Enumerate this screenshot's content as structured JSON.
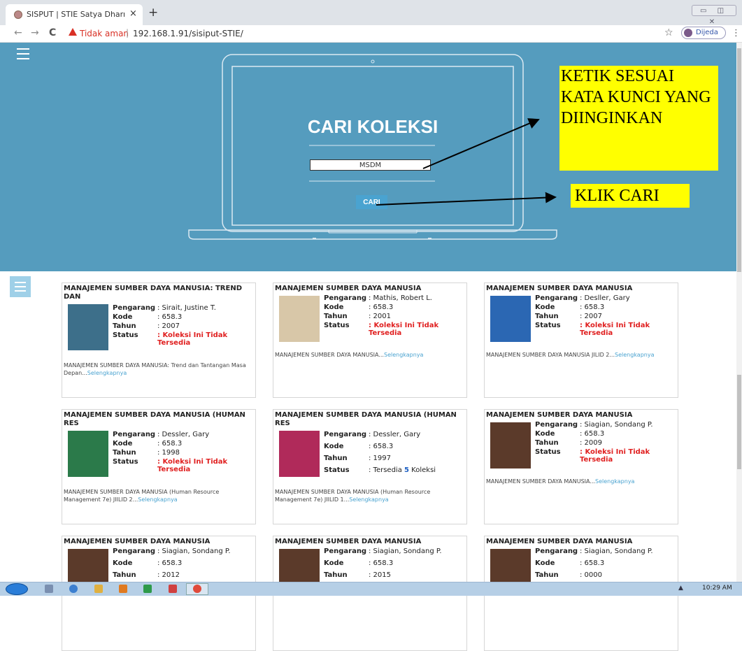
{
  "browser": {
    "tab_title": "SISPUT | STIE Satya Dharma Sing",
    "tab_close": "×",
    "new_tab": "+",
    "back": "←",
    "forward": "→",
    "reload": "C",
    "security_label": "Tidak aman",
    "url_separator": "|",
    "url": "192.168.1.91/sisiput-STIE/",
    "bookmark_star": "☆",
    "profile_name": "Dijeda",
    "menu_dots": "⋮",
    "window_controls": "▭ ◫ ✕"
  },
  "hero": {
    "title": "CARI KOLEKSI",
    "search_value": "MSDM",
    "search_button": "CARI",
    "annotation_keyword": "KETIK SESUAI KATA KUNCI YANG DIINGINKAN",
    "annotation_click": "KLIK CARI",
    "background_color": "#559cbe"
  },
  "results": {
    "label_author": "Pengarang",
    "label_code": "Kode",
    "label_year": "Tahun",
    "label_status": "Status",
    "more_link": "Selengkapnya",
    "cards": [
      {
        "title": "MANAJEMEN SUMBER DAYA MANUSIA: TREND DAN",
        "author": ": Sirait, Justine T.",
        "code": ": 658.3",
        "year": ": 2007",
        "status": ": Koleksi Ini Tidak Tersedia",
        "available": false,
        "description": "MANAJEMEN SUMBER DAYA MANUSIA: Trend dan Tantangan Masa Depan...",
        "cover_color": "#3d6f8a"
      },
      {
        "title": "MANAJEMEN SUMBER DAYA MANUSIA",
        "author": ": Mathis, Robert L.",
        "code": ": 658.3",
        "year": ": 2001",
        "status": ": Koleksi Ini Tidak Tersedia",
        "available": false,
        "description": "MANAJEMEN SUMBER DAYA MANUSIA...",
        "cover_color": "#d8c7a8"
      },
      {
        "title": "MANAJEMEN SUMBER DAYA MANUSIA",
        "author": ": Desller, Gary",
        "code": ": 658.3",
        "year": ": 2007",
        "status": ": Koleksi Ini Tidak Tersedia",
        "available": false,
        "description": "MANAJEMEN SUMBER DAYA MANUSIA JILID 2...",
        "cover_color": "#2b67b3"
      },
      {
        "title": "MANAJEMEN SUMBER DAYA MANUSIA (HUMAN RES",
        "author": ": Dessler, Gary",
        "code": ": 658.3",
        "year": ": 1998",
        "status": ": Koleksi Ini Tidak Tersedia",
        "available": false,
        "description": "MANAJEMEN SUMBER DAYA MANUSIA (Human Resource Management 7e) JIILID 2...",
        "cover_color": "#2b7a4a"
      },
      {
        "title": "MANAJEMEN SUMBER DAYA MANUSIA (HUMAN RES",
        "author": ": Dessler, Gary",
        "code": ": 658.3",
        "year": ": 1997",
        "status_prefix": ": Tersedia ",
        "status_count": "5",
        "status_suffix": " Koleksi",
        "available": true,
        "description": "MANAJEMEN SUMBER DAYA MANUSIA (Human Resource Management 7e) JIILID 1...",
        "cover_color": "#b02a5a"
      },
      {
        "title": "MANAJEMEN SUMBER DAYA MANUSIA",
        "author": ": Siagian, Sondang P.",
        "code": ": 658.3",
        "year": ": 2009",
        "status": ": Koleksi Ini Tidak Tersedia",
        "available": false,
        "description": "MANAJEMEN SUMBER DAYA MANUSIA...",
        "cover_color": "#5b3a2a"
      },
      {
        "title": "MANAJEMEN SUMBER DAYA MANUSIA",
        "author": ": Siagian, Sondang P.",
        "code": ": 658.3",
        "year": ": 2012",
        "cover_color": "#5b3a2a"
      },
      {
        "title": "MANAJEMEN SUMBER DAYA MANUSIA",
        "author": ": Siagian, Sondang P.",
        "code": ": 658.3",
        "year": ": 2015",
        "cover_color": "#5b3a2a"
      },
      {
        "title": "MANAJEMEN SUMBER DAYA MANUSIA",
        "author": ": Siagian, Sondang P.",
        "code": ": 658.3",
        "year": ": 0000",
        "cover_color": "#5b3a2a"
      }
    ]
  },
  "taskbar": {
    "clock": "10:29 AM",
    "tray": "▲"
  }
}
